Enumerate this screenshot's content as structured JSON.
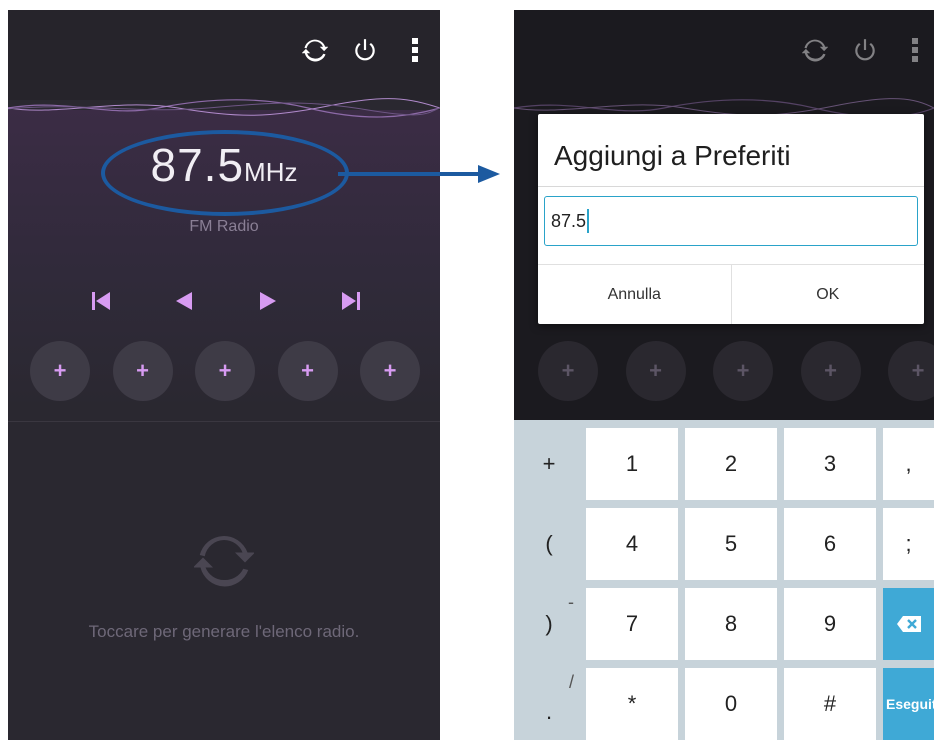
{
  "left_screen": {
    "frequency_value": "87.5",
    "frequency_unit": "MHz",
    "band_label": "FM Radio",
    "toolbar_icons": [
      "refresh-icon",
      "power-icon",
      "more-vert-icon"
    ],
    "transport_icons": [
      "skip-previous-icon",
      "seek-back-icon",
      "seek-forward-icon",
      "skip-next-icon"
    ],
    "presets": [
      "+",
      "+",
      "+",
      "+",
      "+"
    ],
    "empty_hint": "Toccare per generare l'elenco radio."
  },
  "right_screen": {
    "dialog": {
      "title": "Aggiungi a Preferiti",
      "input_value": "87.5",
      "cancel_label": "Annulla",
      "ok_label": "OK"
    },
    "presets": [
      "+",
      "+",
      "+",
      "+",
      "+"
    ],
    "keyboard": {
      "rows": [
        {
          "side": "+",
          "keys": [
            "1",
            "2",
            "3"
          ],
          "extra": ","
        },
        {
          "side": "(",
          "keys": [
            "4",
            "5",
            "6"
          ],
          "extra": ";"
        },
        {
          "side": ")",
          "side_sub": "-",
          "keys": [
            "7",
            "8",
            "9"
          ],
          "extra_icon": "backspace-icon"
        },
        {
          "side": ".",
          "side_sub": "/",
          "keys": [
            "*",
            "0",
            "#"
          ],
          "extra": "Eseguito"
        }
      ]
    }
  },
  "colors": {
    "accent_purple": "#d79bf2",
    "highlight_blue": "#1c5aa0",
    "input_focus": "#2aa3c9",
    "action_key": "#3fa9d6"
  }
}
